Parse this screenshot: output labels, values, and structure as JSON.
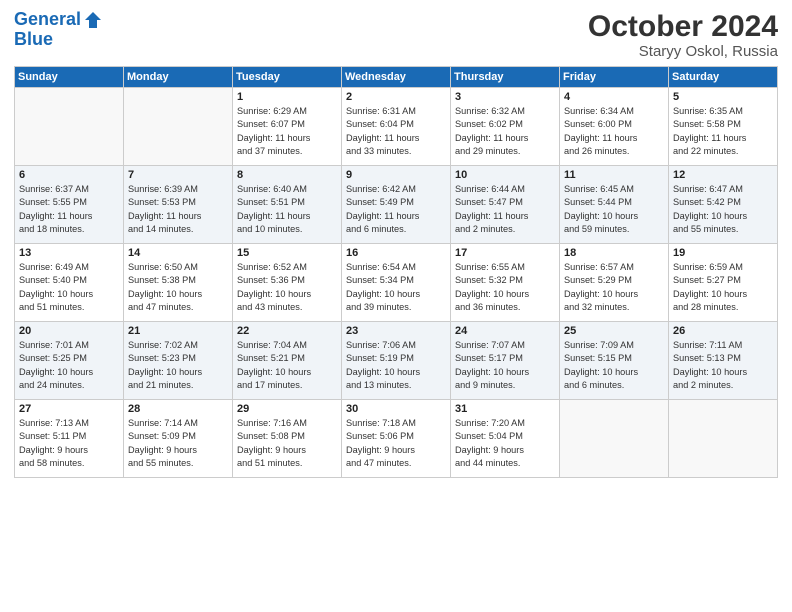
{
  "logo": {
    "line1": "General",
    "line2": "Blue"
  },
  "title": "October 2024",
  "subtitle": "Staryy Oskol, Russia",
  "headers": [
    "Sunday",
    "Monday",
    "Tuesday",
    "Wednesday",
    "Thursday",
    "Friday",
    "Saturday"
  ],
  "weeks": [
    [
      {
        "num": "",
        "info": ""
      },
      {
        "num": "",
        "info": ""
      },
      {
        "num": "1",
        "info": "Sunrise: 6:29 AM\nSunset: 6:07 PM\nDaylight: 11 hours\nand 37 minutes."
      },
      {
        "num": "2",
        "info": "Sunrise: 6:31 AM\nSunset: 6:04 PM\nDaylight: 11 hours\nand 33 minutes."
      },
      {
        "num": "3",
        "info": "Sunrise: 6:32 AM\nSunset: 6:02 PM\nDaylight: 11 hours\nand 29 minutes."
      },
      {
        "num": "4",
        "info": "Sunrise: 6:34 AM\nSunset: 6:00 PM\nDaylight: 11 hours\nand 26 minutes."
      },
      {
        "num": "5",
        "info": "Sunrise: 6:35 AM\nSunset: 5:58 PM\nDaylight: 11 hours\nand 22 minutes."
      }
    ],
    [
      {
        "num": "6",
        "info": "Sunrise: 6:37 AM\nSunset: 5:55 PM\nDaylight: 11 hours\nand 18 minutes."
      },
      {
        "num": "7",
        "info": "Sunrise: 6:39 AM\nSunset: 5:53 PM\nDaylight: 11 hours\nand 14 minutes."
      },
      {
        "num": "8",
        "info": "Sunrise: 6:40 AM\nSunset: 5:51 PM\nDaylight: 11 hours\nand 10 minutes."
      },
      {
        "num": "9",
        "info": "Sunrise: 6:42 AM\nSunset: 5:49 PM\nDaylight: 11 hours\nand 6 minutes."
      },
      {
        "num": "10",
        "info": "Sunrise: 6:44 AM\nSunset: 5:47 PM\nDaylight: 11 hours\nand 2 minutes."
      },
      {
        "num": "11",
        "info": "Sunrise: 6:45 AM\nSunset: 5:44 PM\nDaylight: 10 hours\nand 59 minutes."
      },
      {
        "num": "12",
        "info": "Sunrise: 6:47 AM\nSunset: 5:42 PM\nDaylight: 10 hours\nand 55 minutes."
      }
    ],
    [
      {
        "num": "13",
        "info": "Sunrise: 6:49 AM\nSunset: 5:40 PM\nDaylight: 10 hours\nand 51 minutes."
      },
      {
        "num": "14",
        "info": "Sunrise: 6:50 AM\nSunset: 5:38 PM\nDaylight: 10 hours\nand 47 minutes."
      },
      {
        "num": "15",
        "info": "Sunrise: 6:52 AM\nSunset: 5:36 PM\nDaylight: 10 hours\nand 43 minutes."
      },
      {
        "num": "16",
        "info": "Sunrise: 6:54 AM\nSunset: 5:34 PM\nDaylight: 10 hours\nand 39 minutes."
      },
      {
        "num": "17",
        "info": "Sunrise: 6:55 AM\nSunset: 5:32 PM\nDaylight: 10 hours\nand 36 minutes."
      },
      {
        "num": "18",
        "info": "Sunrise: 6:57 AM\nSunset: 5:29 PM\nDaylight: 10 hours\nand 32 minutes."
      },
      {
        "num": "19",
        "info": "Sunrise: 6:59 AM\nSunset: 5:27 PM\nDaylight: 10 hours\nand 28 minutes."
      }
    ],
    [
      {
        "num": "20",
        "info": "Sunrise: 7:01 AM\nSunset: 5:25 PM\nDaylight: 10 hours\nand 24 minutes."
      },
      {
        "num": "21",
        "info": "Sunrise: 7:02 AM\nSunset: 5:23 PM\nDaylight: 10 hours\nand 21 minutes."
      },
      {
        "num": "22",
        "info": "Sunrise: 7:04 AM\nSunset: 5:21 PM\nDaylight: 10 hours\nand 17 minutes."
      },
      {
        "num": "23",
        "info": "Sunrise: 7:06 AM\nSunset: 5:19 PM\nDaylight: 10 hours\nand 13 minutes."
      },
      {
        "num": "24",
        "info": "Sunrise: 7:07 AM\nSunset: 5:17 PM\nDaylight: 10 hours\nand 9 minutes."
      },
      {
        "num": "25",
        "info": "Sunrise: 7:09 AM\nSunset: 5:15 PM\nDaylight: 10 hours\nand 6 minutes."
      },
      {
        "num": "26",
        "info": "Sunrise: 7:11 AM\nSunset: 5:13 PM\nDaylight: 10 hours\nand 2 minutes."
      }
    ],
    [
      {
        "num": "27",
        "info": "Sunrise: 7:13 AM\nSunset: 5:11 PM\nDaylight: 9 hours\nand 58 minutes."
      },
      {
        "num": "28",
        "info": "Sunrise: 7:14 AM\nSunset: 5:09 PM\nDaylight: 9 hours\nand 55 minutes."
      },
      {
        "num": "29",
        "info": "Sunrise: 7:16 AM\nSunset: 5:08 PM\nDaylight: 9 hours\nand 51 minutes."
      },
      {
        "num": "30",
        "info": "Sunrise: 7:18 AM\nSunset: 5:06 PM\nDaylight: 9 hours\nand 47 minutes."
      },
      {
        "num": "31",
        "info": "Sunrise: 7:20 AM\nSunset: 5:04 PM\nDaylight: 9 hours\nand 44 minutes."
      },
      {
        "num": "",
        "info": ""
      },
      {
        "num": "",
        "info": ""
      }
    ]
  ]
}
